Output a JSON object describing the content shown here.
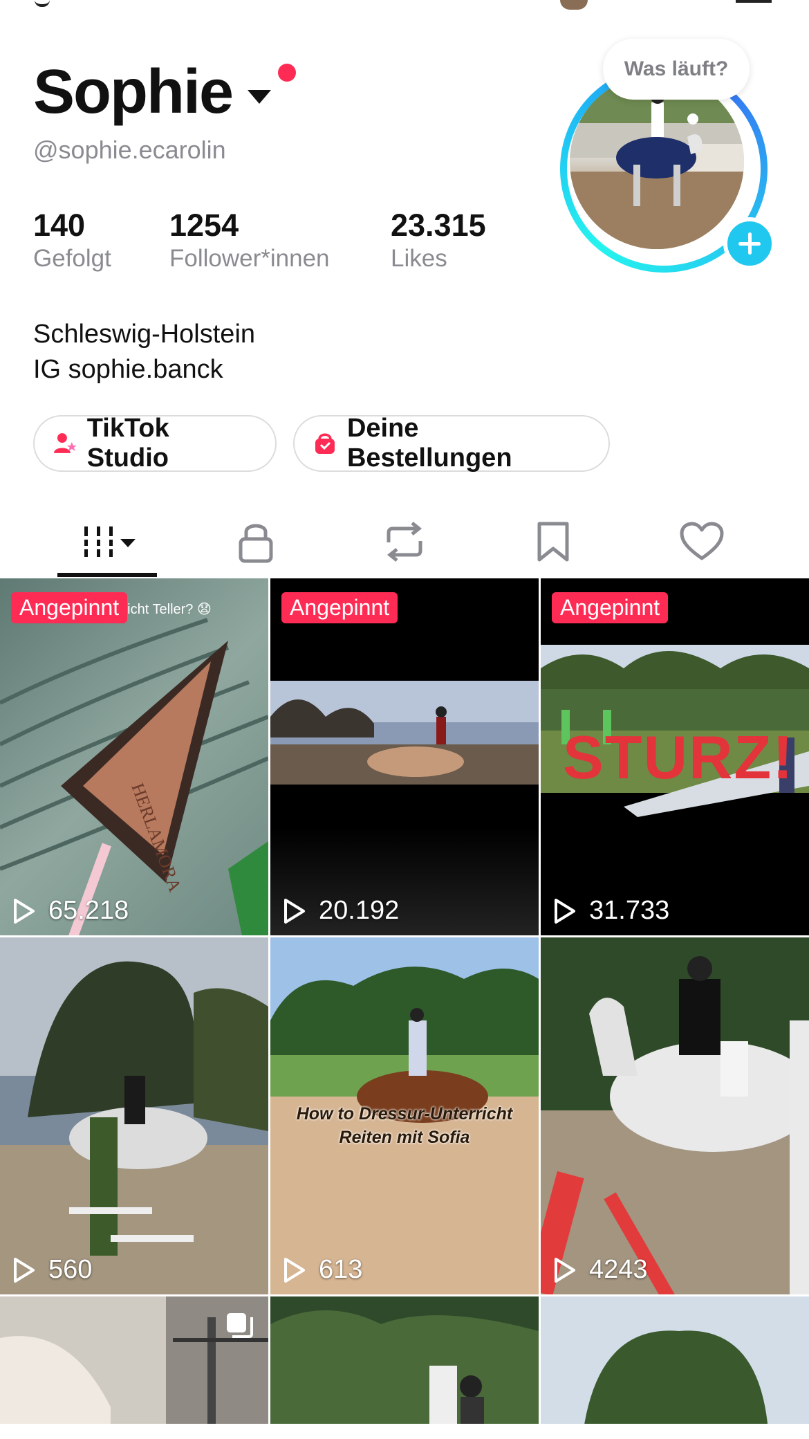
{
  "profile": {
    "name": "Sophie",
    "handle": "@sophie.ecarolin",
    "status_bubble": "Was läuft?",
    "stats": [
      {
        "value": "140",
        "label": "Gefolgt"
      },
      {
        "value": "1254",
        "label": "Follower*innen"
      },
      {
        "value": "23.315",
        "label": "Likes"
      }
    ],
    "bio_line1": "Schleswig-Holstein",
    "bio_line2": "IG sophie.banck"
  },
  "buttons": {
    "studio": "TikTok Studio",
    "orders": "Deine Bestellungen"
  },
  "tabs": [
    "videos-grid",
    "private-lock",
    "reposts",
    "favorites",
    "liked"
  ],
  "videos": [
    {
      "pinned_label": "Angepinnt",
      "views": "65.218",
      "overlay": "s einem Nicht Teller? 😧"
    },
    {
      "pinned_label": "Angepinnt",
      "views": "20.192"
    },
    {
      "pinned_label": "Angepinnt",
      "views": "31.733",
      "overlay": "STURZ!"
    },
    {
      "views": "560"
    },
    {
      "views": "613",
      "overlay1": "How to Dressur-Unterricht",
      "overlay2": "Reiten mit Sofia"
    },
    {
      "views": "4243"
    },
    {},
    {},
    {}
  ],
  "product_name": "HERLAMORA",
  "colors": {
    "accent": "#fe2c55",
    "ring": "#25f4ee",
    "plus": "#20c8f0"
  }
}
